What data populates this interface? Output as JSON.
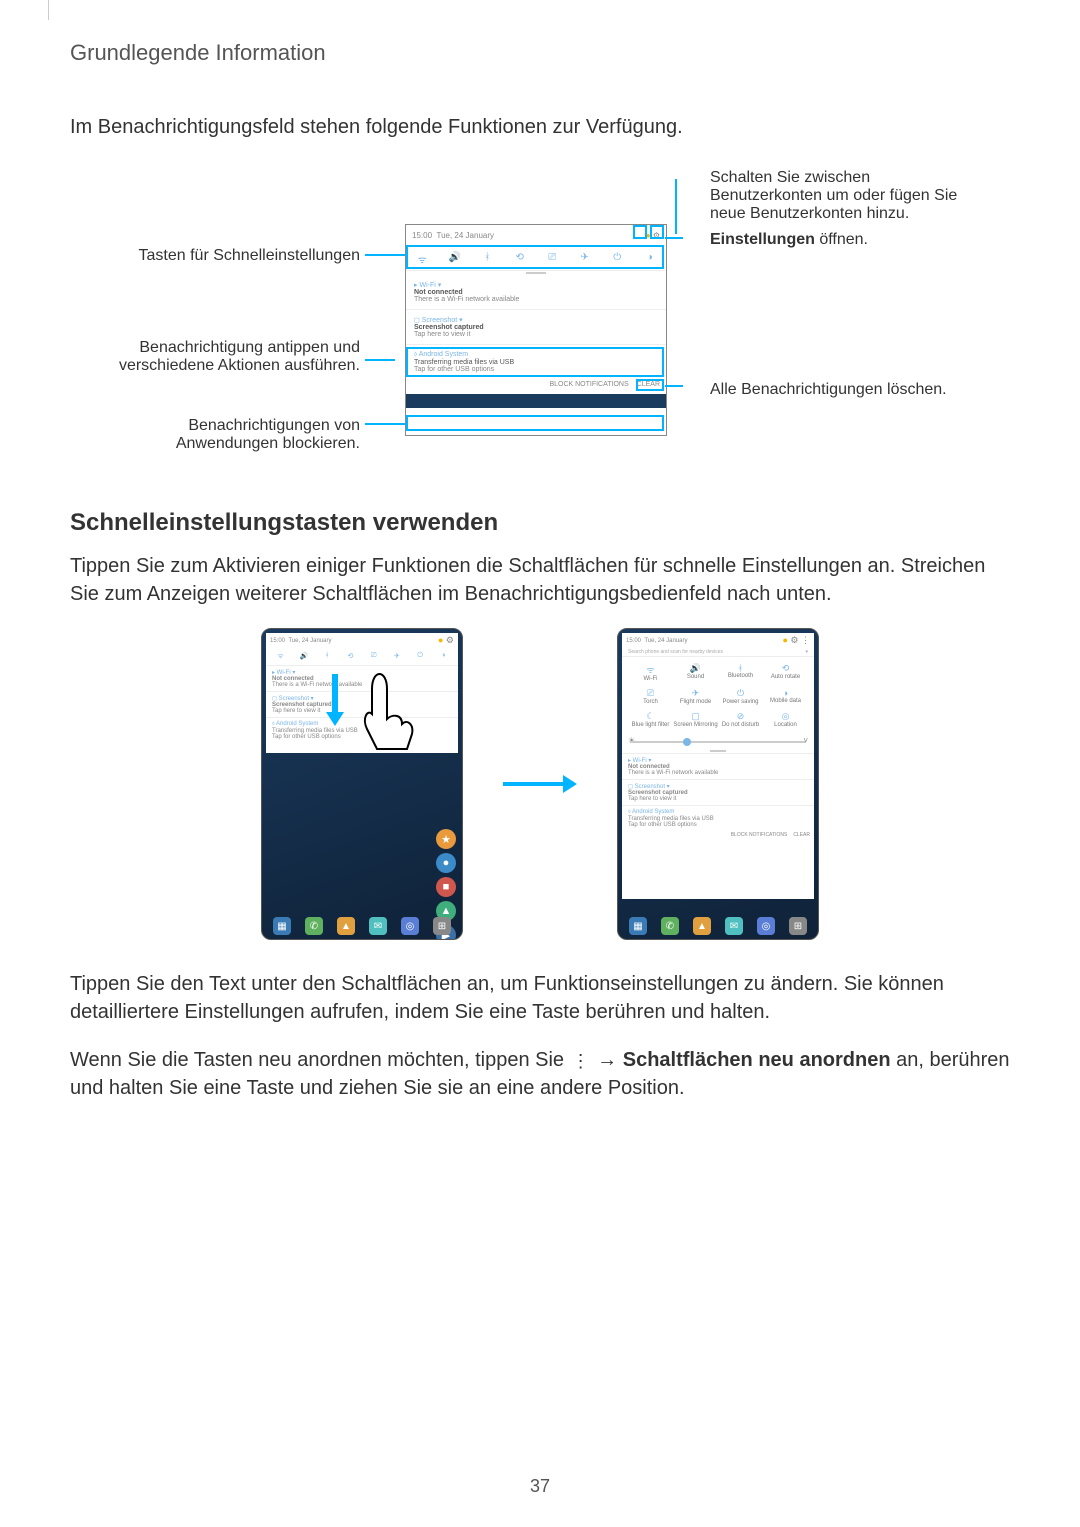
{
  "header": {
    "section": "Grundlegende Information"
  },
  "intro": "Im Benachrichtigungsfeld stehen folgende Funktionen zur Verfügung.",
  "diagram": {
    "left": {
      "quick_settings": "Tasten für Schnelleinstellungen",
      "tap_notification": "Benachrichtigung antippen und verschiedene Aktionen ausführen.",
      "block_notifications": "Benachrichtigungen von Anwendungen blockieren."
    },
    "right": {
      "switch_accounts": "Schalten Sie zwischen Benutzerkonten um oder fügen Sie neue Benutzerkonten hinzu.",
      "open_settings_bold": "Einstellungen",
      "open_settings_rest": " öffnen.",
      "clear_all": "Alle Benachrichtigungen löschen."
    },
    "device": {
      "time": "15:00",
      "date": "Tue, 24 January",
      "notifs": [
        {
          "title": "▸ Wi-Fi ▾",
          "line1": "Not connected",
          "line2": "There is a Wi-Fi network available"
        },
        {
          "title": "◻ Screenshot ▾",
          "line1": "Screenshot captured",
          "line2": "Tap here to view it"
        },
        {
          "title": "⬨ Android System",
          "line1": "Transferring media files via USB",
          "line2": "Tap for other USB options"
        }
      ],
      "footer": {
        "block": "BLOCK NOTIFICATIONS",
        "clear": "CLEAR"
      }
    }
  },
  "subhead": "Schnelleinstellungstasten verwenden",
  "para1": "Tippen Sie zum Aktivieren einiger Funktionen die Schaltflächen für schnelle Einstellungen an. Streichen Sie zum Anzeigen weiterer Schaltflächen im Benachrichtigungsbedienfeld nach unten.",
  "screens": {
    "panel_time": "15:00",
    "panel_date": "Tue, 24 January",
    "search_placeholder": "Search phone and scan for nearby devices",
    "qs_labels": [
      "Wi-Fi",
      "Sound",
      "Bluetooth",
      "Auto rotate",
      "Torch",
      "Flight mode",
      "Power saving",
      "Mobile data",
      "Blue light filter",
      "Screen Mirroring",
      "Do not disturb",
      "Location"
    ],
    "brightness_label": "☀"
  },
  "para2": "Tippen Sie den Text unter den Schaltflächen an, um Funktionseinstellungen zu ändern. Sie können detailliertere Einstellungen aufrufen, indem Sie eine Taste berühren und halten.",
  "para3_a": "Wenn Sie die Tasten neu anordnen möchten, tippen Sie ",
  "para3_arrow": " → ",
  "para3_bold": "Schaltflächen neu anordnen",
  "para3_b": " an, berühren und halten Sie eine Taste und ziehen Sie sie an eine andere Position.",
  "page_number": "37"
}
